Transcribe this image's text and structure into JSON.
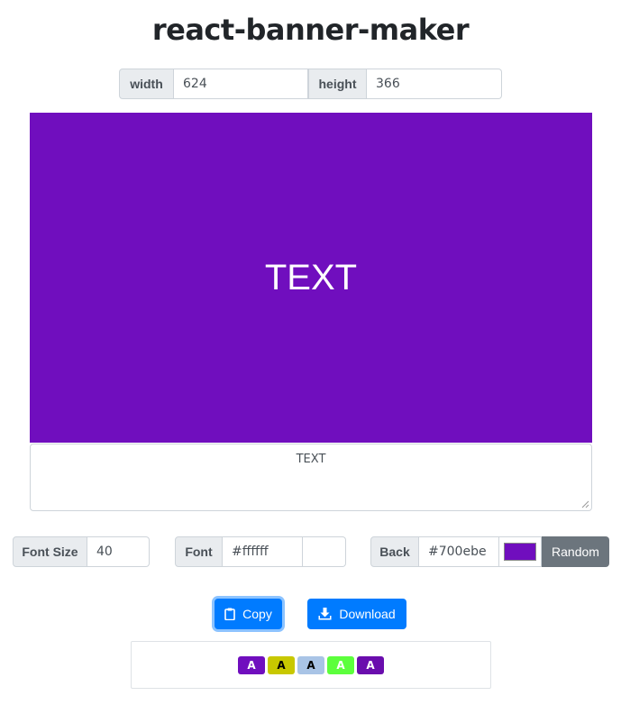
{
  "app": {
    "title": "react-banner-maker"
  },
  "size": {
    "width_label": "width",
    "width_value": "624",
    "height_label": "height",
    "height_value": "366"
  },
  "banner": {
    "text": "TEXT",
    "text_color": "#ffffff",
    "background": "#700ebe",
    "font_size": 40
  },
  "editor": {
    "text": "TEXT"
  },
  "controls": {
    "font_size_label": "Font Size",
    "font_size_value": "40",
    "font_label": "Font",
    "font_color_value": "#ffffff",
    "font_swatch": "#ffffff",
    "back_label": "Back",
    "back_color_value": "#700ebe",
    "back_swatch": "#700ebe",
    "random_label": "Random"
  },
  "actions": {
    "copy_label": "Copy",
    "copy_icon": "clipboard-icon",
    "download_label": "Download",
    "download_icon": "download-icon"
  },
  "presets": [
    {
      "label": "A",
      "bg": "#700ebe",
      "fg": "#ffffff"
    },
    {
      "label": "A",
      "bg": "#c8c800",
      "fg": "#000000"
    },
    {
      "label": "A",
      "bg": "#a9c4e6",
      "fg": "#000000"
    },
    {
      "label": "A",
      "bg": "#5cff3c",
      "fg": "#ffffff"
    },
    {
      "label": "A",
      "bg": "#6a0dad",
      "fg": "#ffffff"
    }
  ]
}
